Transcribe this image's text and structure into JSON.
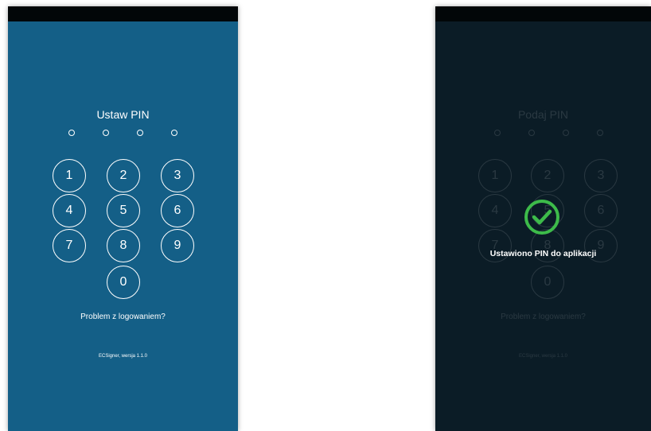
{
  "set_pin_screen": {
    "title": "Ustaw PIN",
    "pin_length": 4,
    "keys": [
      "1",
      "2",
      "3",
      "4",
      "5",
      "6",
      "7",
      "8",
      "9",
      "0"
    ],
    "problem_link": "Problem z logowaniem?",
    "version": "ECSigner, wersja 1.1.0"
  },
  "confirm_screen": {
    "title": "Podaj PIN",
    "pin_length": 4,
    "keys": [
      "1",
      "2",
      "3",
      "4",
      "5",
      "6",
      "7",
      "8",
      "9",
      "0"
    ],
    "problem_link": "Problem z logowaniem?",
    "version": "ECSigner, wersja 1.1.0",
    "overlay": {
      "icon": "check-circle-icon",
      "message": "Ustawiono PIN do aplikacji"
    }
  },
  "colors": {
    "left_background": "#145f87",
    "right_background": "#0b1c26",
    "status_bar": "#020608",
    "success": "#3dbb4a"
  }
}
